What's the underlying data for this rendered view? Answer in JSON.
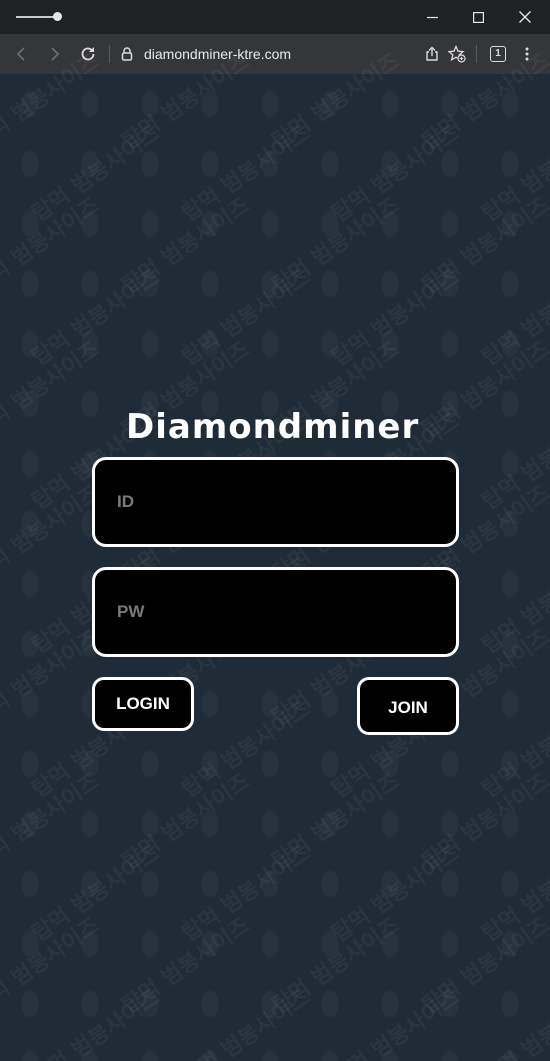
{
  "browser": {
    "url": "diamondminer-ktre.com",
    "tab_count": "1",
    "icons": {
      "back": "arrow-left-icon",
      "forward": "arrow-right-icon",
      "reload": "reload-icon",
      "lock": "lock-icon",
      "share": "share-icon",
      "bookmark": "star-add-icon",
      "tabs": "tab-switcher-icon",
      "menu": "kebab-menu-icon",
      "minimize": "minimize-icon",
      "maximize": "maximize-icon",
      "close": "close-icon"
    }
  },
  "login": {
    "title": "Diamondminer",
    "id_placeholder": "ID",
    "pw_placeholder": "PW",
    "login_label": "LOGIN",
    "join_label": "JOIN"
  },
  "watermark_text": "탑먹 범봉사이즈",
  "colors": {
    "page_background": "#1f2b36",
    "field_background": "#000000",
    "border": "#ffffff",
    "placeholder": "#7a7a7a"
  }
}
